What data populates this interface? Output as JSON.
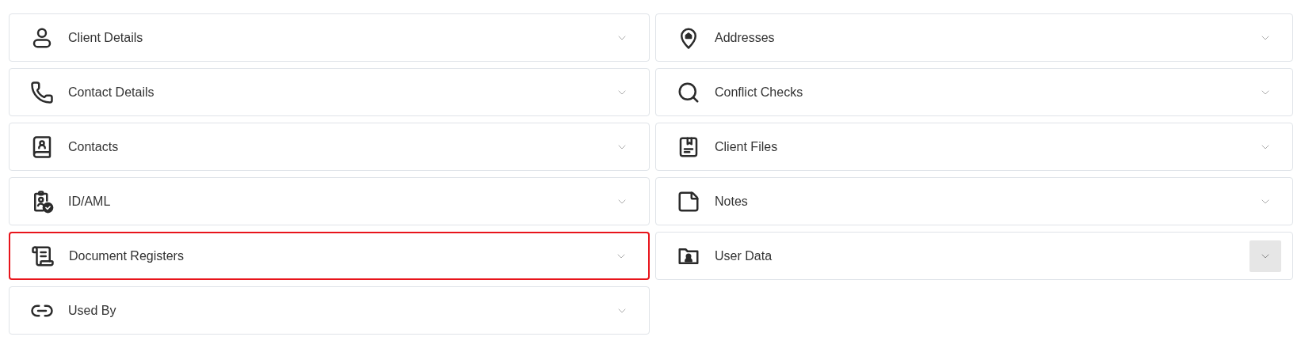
{
  "panels": [
    {
      "title": "Client Details",
      "expanded": false,
      "focused": false,
      "hovered": false
    },
    {
      "title": "Addresses",
      "expanded": false,
      "focused": false,
      "hovered": false
    },
    {
      "title": "Contact Details",
      "expanded": false,
      "focused": false,
      "hovered": false
    },
    {
      "title": "Conflict Checks",
      "expanded": false,
      "focused": false,
      "hovered": false
    },
    {
      "title": "Contacts",
      "expanded": false,
      "focused": false,
      "hovered": false
    },
    {
      "title": "Client Files",
      "expanded": false,
      "focused": false,
      "hovered": false
    },
    {
      "title": "ID/AML",
      "expanded": false,
      "focused": false,
      "hovered": false
    },
    {
      "title": "Notes",
      "expanded": false,
      "focused": false,
      "hovered": false
    },
    {
      "title": "Document Registers",
      "expanded": false,
      "focused": true,
      "hovered": false
    },
    {
      "title": "User Data",
      "expanded": false,
      "focused": false,
      "hovered": true
    },
    {
      "title": "Used By",
      "expanded": false,
      "focused": false,
      "hovered": false
    }
  ]
}
